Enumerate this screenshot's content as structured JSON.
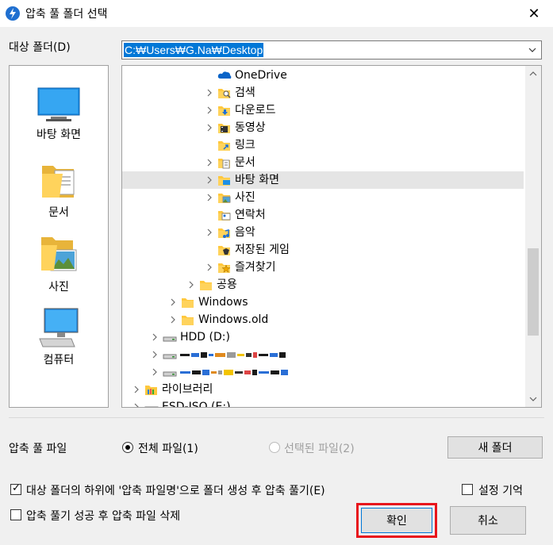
{
  "window": {
    "title": "압축 풀 폴더 선택",
    "close_glyph": "✕"
  },
  "target": {
    "label": "대상 폴더(D)",
    "path": "C:₩Users₩G.Na₩Desktop"
  },
  "places": [
    {
      "label": "바탕 화면",
      "icon": "desktop-icon"
    },
    {
      "label": "문서",
      "icon": "documents-icon"
    },
    {
      "label": "사진",
      "icon": "pictures-icon"
    },
    {
      "label": "컴퓨터",
      "icon": "computer-icon"
    }
  ],
  "tree": [
    {
      "label": "OneDrive",
      "icon": "onedrive-icon",
      "expander": false,
      "level": 4
    },
    {
      "label": "검색",
      "icon": "search-folder-icon",
      "expander": true,
      "level": 4
    },
    {
      "label": "다운로드",
      "icon": "downloads-icon",
      "expander": true,
      "level": 4
    },
    {
      "label": "동영상",
      "icon": "videos-icon",
      "expander": true,
      "level": 4
    },
    {
      "label": "링크",
      "icon": "links-icon",
      "expander": false,
      "level": 4
    },
    {
      "label": "문서",
      "icon": "documents-icon",
      "expander": true,
      "level": 4
    },
    {
      "label": "바탕 화면",
      "icon": "desktop-folder-icon",
      "expander": true,
      "level": 4,
      "selected": true
    },
    {
      "label": "사진",
      "icon": "pictures-folder-icon",
      "expander": true,
      "level": 4
    },
    {
      "label": "연락처",
      "icon": "contacts-icon",
      "expander": false,
      "level": 4
    },
    {
      "label": "음악",
      "icon": "music-icon",
      "expander": true,
      "level": 4
    },
    {
      "label": "저장된 게임",
      "icon": "saved-games-icon",
      "expander": false,
      "level": 4
    },
    {
      "label": "즐겨찾기",
      "icon": "favorites-icon",
      "expander": true,
      "level": 4
    },
    {
      "label": "공용",
      "icon": "folder-icon",
      "expander": true,
      "level": 3
    },
    {
      "label": "Windows",
      "icon": "folder-icon",
      "expander": true,
      "level": 2
    },
    {
      "label": "Windows.old",
      "icon": "folder-icon",
      "expander": true,
      "level": 2
    },
    {
      "label": "HDD (D:)",
      "icon": "drive-icon",
      "expander": true,
      "level": 1
    },
    {
      "label": "",
      "icon": "drive-icon",
      "expander": true,
      "level": 1,
      "censored": true
    },
    {
      "label": "",
      "icon": "drive-icon",
      "expander": true,
      "level": 1,
      "censored": true
    },
    {
      "label": "라이브러리",
      "icon": "library-icon",
      "expander": true,
      "level": 0
    },
    {
      "label": "ESD-ISO (E:)",
      "icon": "drive-icon",
      "expander": true,
      "level": 0
    }
  ],
  "extract": {
    "label": "압축 풀 파일",
    "all_label": "전체 파일(1)",
    "selected_label": "선택된 파일(2)",
    "new_folder_label": "새 폴더"
  },
  "options": {
    "create_folder_label": "대상 폴더의 하위에 '압축 파일명'으로 폴더 생성 후 압축 풀기(E)",
    "create_folder_checked": true,
    "remember_label": "설정 기억",
    "remember_checked": false,
    "delete_label": "압축 풀기 성공 후 압축 파일 삭제",
    "delete_checked": false
  },
  "buttons": {
    "ok_label": "확인",
    "cancel_label": "취소"
  },
  "colors": {
    "selection": "#0078d7",
    "highlight_box": "#e8141c",
    "folder": "#ffc83d"
  }
}
